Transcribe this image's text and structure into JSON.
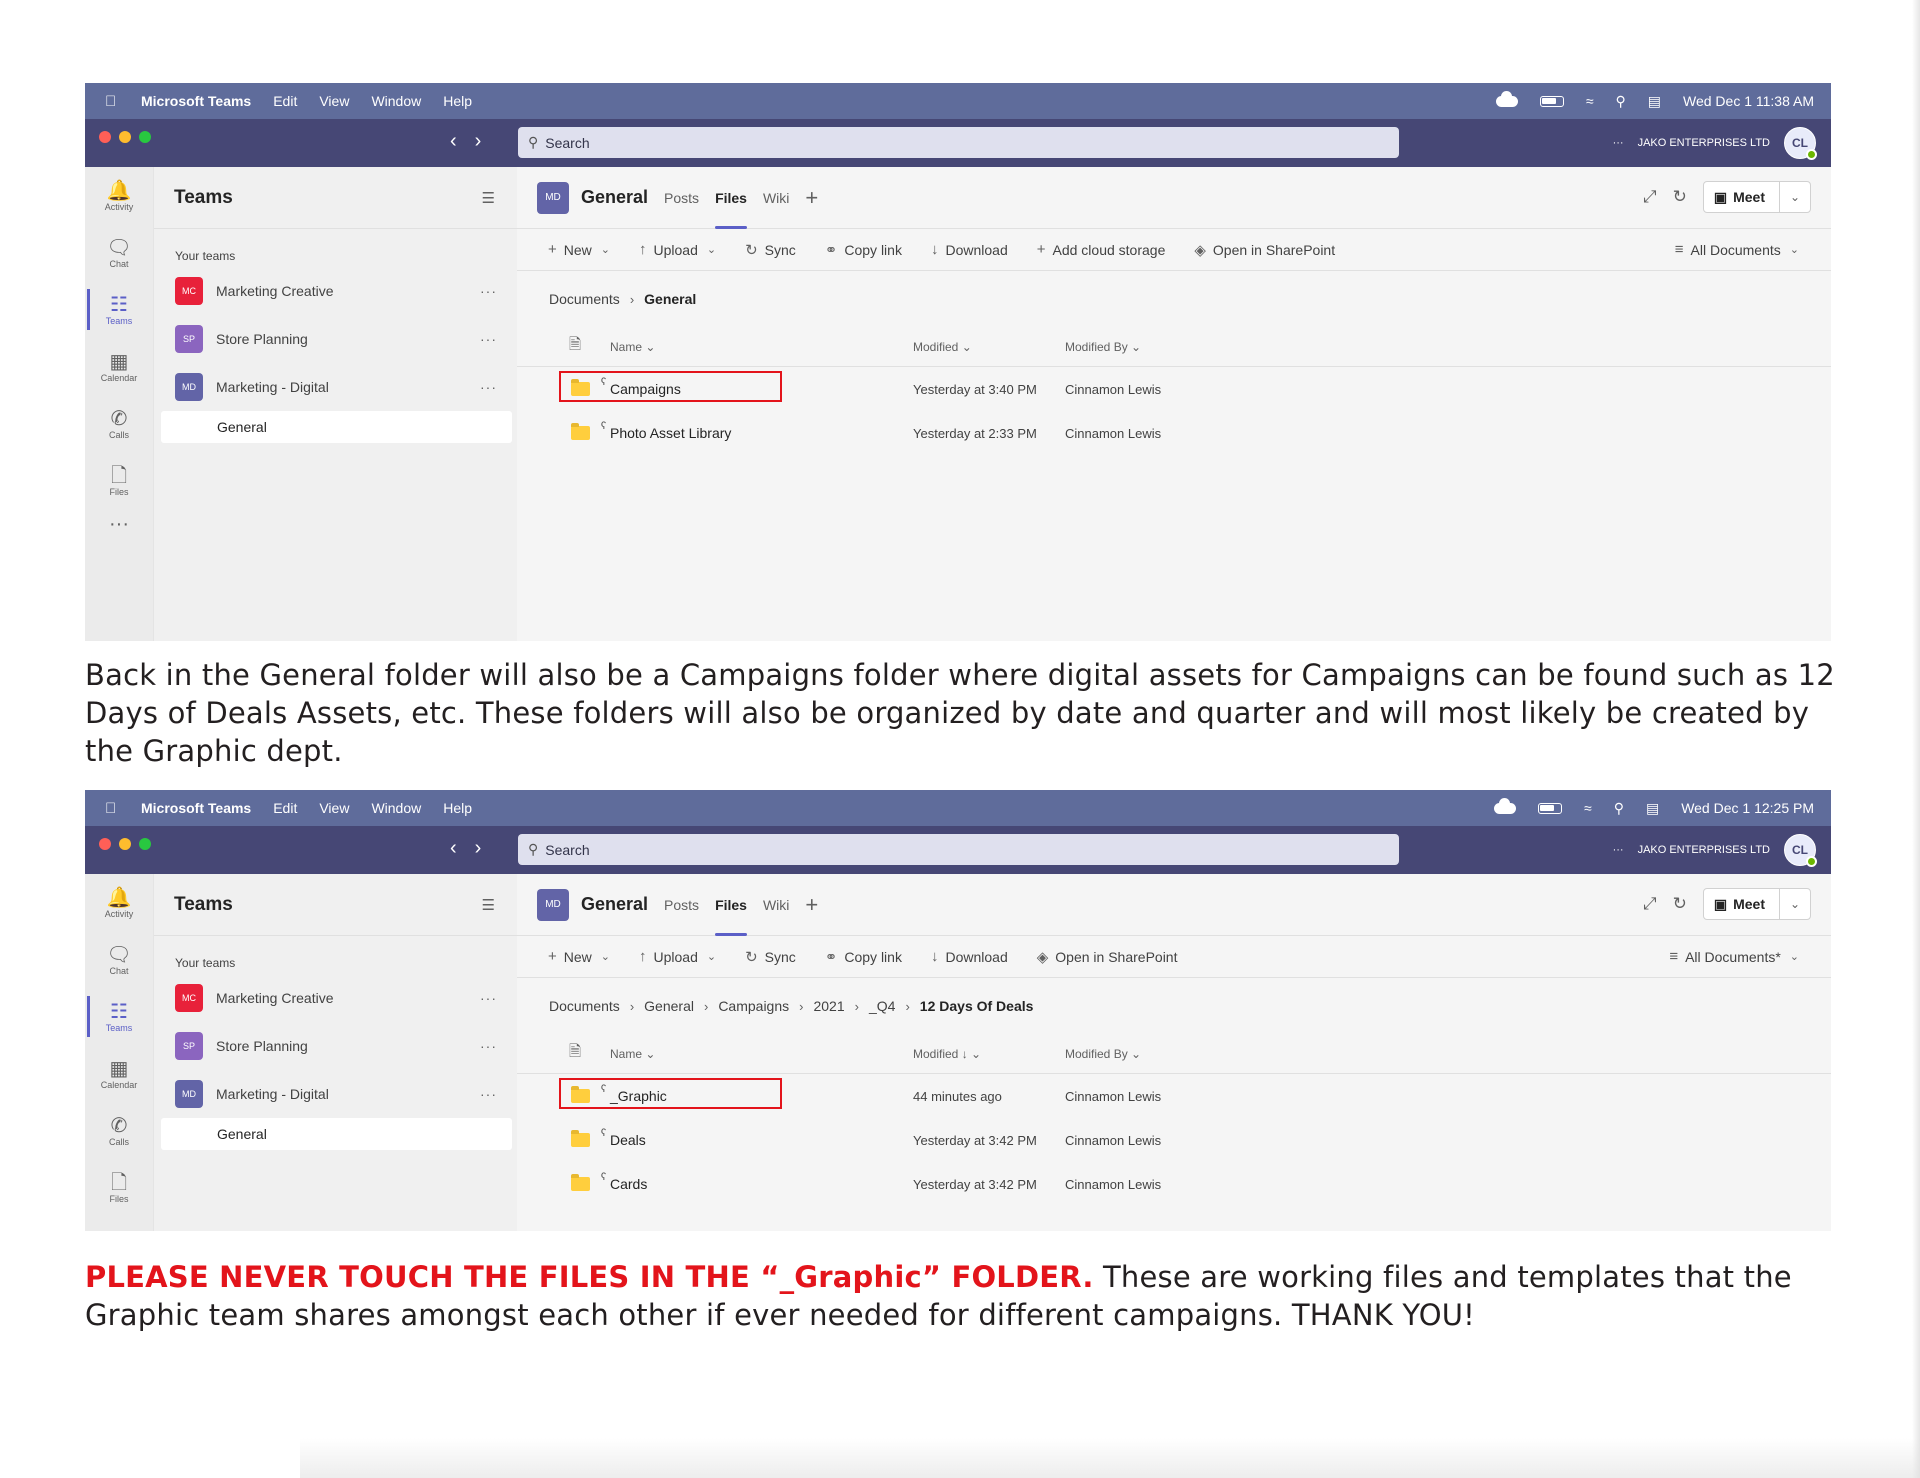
{
  "screens": [
    {
      "menubar": {
        "app": "Microsoft Teams",
        "items": [
          "Edit",
          "View",
          "Window",
          "Help"
        ],
        "datetime": "Wed Dec 1  11:38 AM"
      },
      "titlebar": {
        "search_placeholder": "Search",
        "more": "···",
        "org": "JAKO ENTERPRISES LTD",
        "avatar": "CL"
      },
      "rail": [
        {
          "label": "Activity",
          "icon": "bell-icon"
        },
        {
          "label": "Chat",
          "icon": "chat-icon"
        },
        {
          "label": "Teams",
          "icon": "teams-icon",
          "active": true
        },
        {
          "label": "Calendar",
          "icon": "calendar-icon"
        },
        {
          "label": "Calls",
          "icon": "phone-icon"
        },
        {
          "label": "Files",
          "icon": "file-icon"
        }
      ],
      "rail_more": "···",
      "sidebar": {
        "title": "Teams",
        "caption": "Your teams",
        "teams": [
          {
            "initials": "MC",
            "name": "Marketing Creative",
            "color": "#e8213a"
          },
          {
            "initials": "SP",
            "name": "Store Planning",
            "color": "#8b65bf"
          },
          {
            "initials": "MD",
            "name": "Marketing - Digital",
            "color": "#6264a7"
          }
        ],
        "channel": "General"
      },
      "channel_header": {
        "initials": "MD",
        "title": "General",
        "tabs": [
          "Posts",
          "Files",
          "Wiki"
        ],
        "active_tab": "Files",
        "meet": "Meet"
      },
      "commands": [
        "New",
        "Upload",
        "Sync",
        "Copy link",
        "Download",
        "Add cloud storage",
        "Open in SharePoint"
      ],
      "view": "All Documents",
      "breadcrumb": [
        "Documents",
        "General"
      ],
      "columns": {
        "name": "Name",
        "modified": "Modified",
        "modified_by": "Modified By"
      },
      "rows": [
        {
          "name": "Campaigns",
          "modified": "Yesterday at 3:40 PM",
          "by": "Cinnamon Lewis",
          "highlight": true
        },
        {
          "name": "Photo Asset Library",
          "modified": "Yesterday at 2:33 PM",
          "by": "Cinnamon Lewis",
          "highlight": false
        }
      ]
    },
    {
      "menubar": {
        "app": "Microsoft Teams",
        "items": [
          "Edit",
          "View",
          "Window",
          "Help"
        ],
        "datetime": "Wed Dec 1  12:25 PM"
      },
      "titlebar": {
        "search_placeholder": "Search",
        "more": "···",
        "org": "JAKO ENTERPRISES LTD",
        "avatar": "CL"
      },
      "rail": [
        {
          "label": "Activity",
          "icon": "bell-icon"
        },
        {
          "label": "Chat",
          "icon": "chat-icon"
        },
        {
          "label": "Teams",
          "icon": "teams-icon",
          "active": true
        },
        {
          "label": "Calendar",
          "icon": "calendar-icon"
        },
        {
          "label": "Calls",
          "icon": "phone-icon"
        },
        {
          "label": "Files",
          "icon": "file-icon"
        }
      ],
      "sidebar": {
        "title": "Teams",
        "caption": "Your teams",
        "teams": [
          {
            "initials": "MC",
            "name": "Marketing Creative",
            "color": "#e8213a"
          },
          {
            "initials": "SP",
            "name": "Store Planning",
            "color": "#8b65bf"
          },
          {
            "initials": "MD",
            "name": "Marketing - Digital",
            "color": "#6264a7"
          }
        ],
        "channel": "General"
      },
      "channel_header": {
        "initials": "MD",
        "title": "General",
        "tabs": [
          "Posts",
          "Files",
          "Wiki"
        ],
        "active_tab": "Files",
        "meet": "Meet"
      },
      "commands": [
        "New",
        "Upload",
        "Sync",
        "Copy link",
        "Download",
        "Open in SharePoint"
      ],
      "view": "All Documents*",
      "breadcrumb": [
        "Documents",
        "General",
        "Campaigns",
        "2021",
        "_Q4",
        "12 Days Of Deals"
      ],
      "columns": {
        "name": "Name",
        "modified": "Modified ↓",
        "modified_by": "Modified By"
      },
      "rows": [
        {
          "name": "_Graphic",
          "modified": "44 minutes ago",
          "by": "Cinnamon Lewis",
          "highlight": true
        },
        {
          "name": "Deals",
          "modified": "Yesterday at 3:42 PM",
          "by": "Cinnamon Lewis",
          "highlight": false
        },
        {
          "name": "Cards",
          "modified": "Yesterday at 3:42 PM",
          "by": "Cinnamon Lewis",
          "highlight": false
        }
      ]
    }
  ],
  "captions": {
    "first": "Back in the General folder will also be a Campaigns folder where digital assets for Campaigns can be found such as 12 Days of Deals Assets, etc. These folders will also be organized by date and quarter and will most likely be created by the Graphic dept.",
    "second_warning": "PLEASE NEVER TOUCH THE FILES IN THE “_Graphic” FOLDER.",
    "second_rest": " These are working files and templates that the Graphic team shares amongst each other if ever needed for different campaigns. THANK YOU!"
  },
  "colors": {
    "accent": "#5b5fc7",
    "titlebar": "#464775",
    "menubar": "#5f6c9b",
    "highlight_red": "#e3141b"
  }
}
